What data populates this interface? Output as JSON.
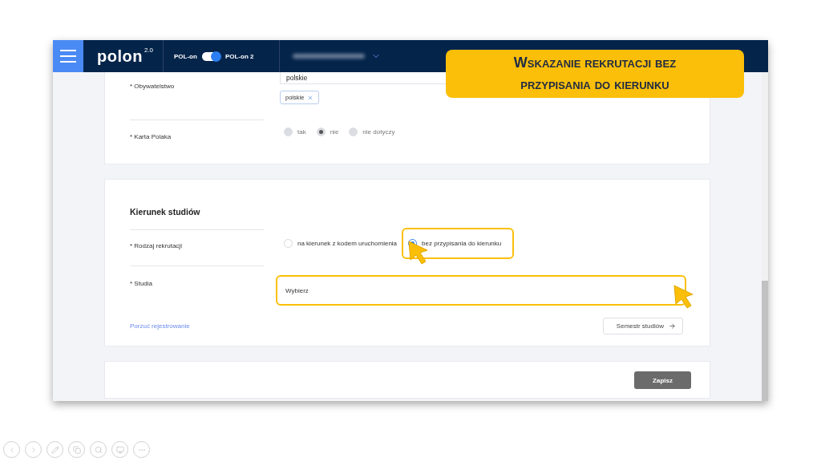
{
  "header": {
    "logo": "polon",
    "logo_version": "2.0",
    "toggle": {
      "left_label": "POL-on",
      "right_label": "POL-on 2",
      "on": true
    }
  },
  "callout": {
    "title": "Wskazanie rekrutacji bez przypisania do kierunku"
  },
  "citizenship": {
    "label": "* Obywatelstwo",
    "value": "polskie",
    "chips": [
      "polskie"
    ]
  },
  "polish_card": {
    "label": "* Karta Polaka",
    "disabled": true,
    "options": [
      {
        "label": "tak",
        "selected": false
      },
      {
        "label": "nie",
        "selected": true
      },
      {
        "label": "nie dotyczy",
        "selected": false
      }
    ]
  },
  "study_direction": {
    "title": "Kierunek studiów",
    "recruitment": {
      "label": "* Rodzaj rekrutacji",
      "options": [
        {
          "label": "na kierunek z kodem uruchomienia",
          "selected": false,
          "highlighted": false
        },
        {
          "label": "bez przypisania do kierunku",
          "selected": true,
          "highlighted": true
        }
      ]
    },
    "studies": {
      "label": "* Studia",
      "placeholder": "Wybierz",
      "highlighted": true
    },
    "link": "Porzuć rejestrowanie",
    "next_button": "Semestr studiów"
  },
  "save_button": "Zapisz"
}
